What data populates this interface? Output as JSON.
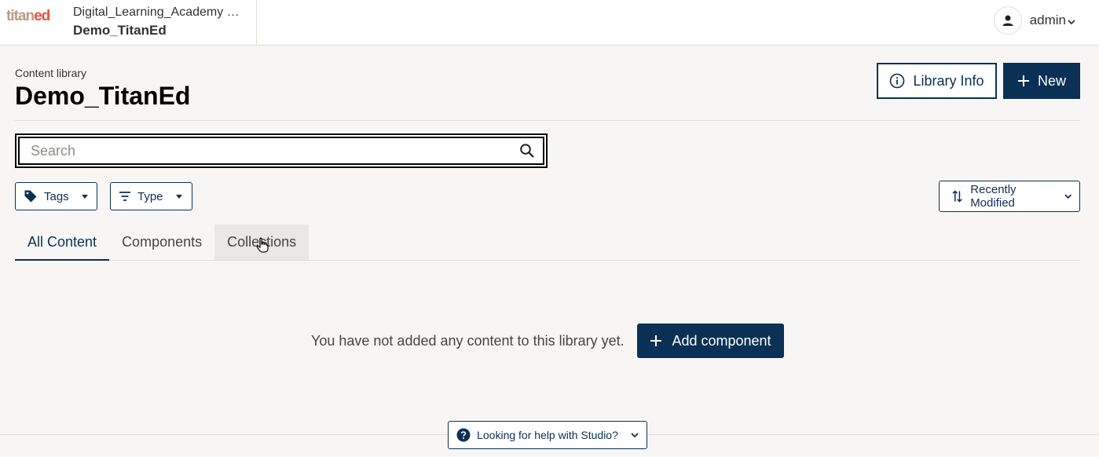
{
  "header": {
    "logo_part1": "titan",
    "logo_part2": "ed",
    "org_name": "Digital_Learning_Academy …",
    "course_name": "Demo_TitanEd",
    "user_name": "admin"
  },
  "title_area": {
    "breadcrumb": "Content library",
    "title": "Demo_TitanEd",
    "library_info_label": "Library Info",
    "new_label": "New"
  },
  "search": {
    "placeholder": "Search",
    "value": ""
  },
  "filters": {
    "tags_label": "Tags",
    "type_label": "Type",
    "sort_label": "Recently Modified"
  },
  "tabs": [
    {
      "label": "All Content",
      "active": true
    },
    {
      "label": "Components",
      "active": false
    },
    {
      "label": "Collections",
      "active": false
    }
  ],
  "empty_state": {
    "message": "You have not added any content to this library yet.",
    "add_label": "Add component"
  },
  "footer": {
    "help_label": "Looking for help with Studio?"
  },
  "colors": {
    "primary": "#0a3055",
    "background": "#f7f6f4",
    "logo_accent": "#e5523c"
  }
}
